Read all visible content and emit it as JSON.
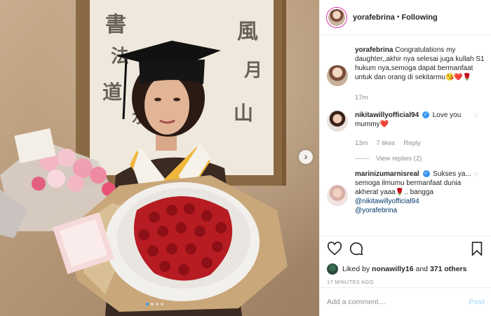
{
  "post": {
    "photo_alt": "",
    "carousel_dots": 4,
    "carousel_active": 1
  },
  "header": {
    "username": "yorafebrina",
    "separator": "•",
    "follow_status": "Following"
  },
  "comments": [
    {
      "username": "yorafebrina",
      "text": "Congratulations my daughter,,akhir nya selesai juga kullah S1 hukum nya,semoga dapat bermanfaat untuk dan orang di sekitarmu😘❤️🌹",
      "time": "17m"
    },
    {
      "username": "nikitawillyofficial94",
      "verified": true,
      "text": "Love you mummy❤️",
      "time": "13m",
      "likes": "7 likes",
      "reply_label": "Reply",
      "view_replies": "View replies (2)"
    },
    {
      "username": "marinizumarnisreal",
      "verified": true,
      "text": "Sukses ya... semoga ilmumu bermanfaat dunia akherat yaaa🌹.. bangga",
      "mention1": "@nikitawillyofficial94",
      "mention2": "@yorafebrina"
    }
  ],
  "actions": {
    "likes_prefix": "Liked by",
    "likes_user": "nonawilly16",
    "likes_and": "and",
    "likes_others": "371 others",
    "timestamp": "17 MINUTES AGO"
  },
  "add_comment": {
    "placeholder": "Add a comment…",
    "post_label": "Post"
  },
  "colors": {
    "accent": "#3897f0",
    "post_disabled": "#b2dffc",
    "muted": "#8e8e8e",
    "heart": "#ed4956"
  },
  "icons": [
    "heart-icon",
    "comment-icon",
    "bookmark-icon",
    "chevron-right-icon",
    "small-heart-icon",
    "verified-badge-icon"
  ]
}
